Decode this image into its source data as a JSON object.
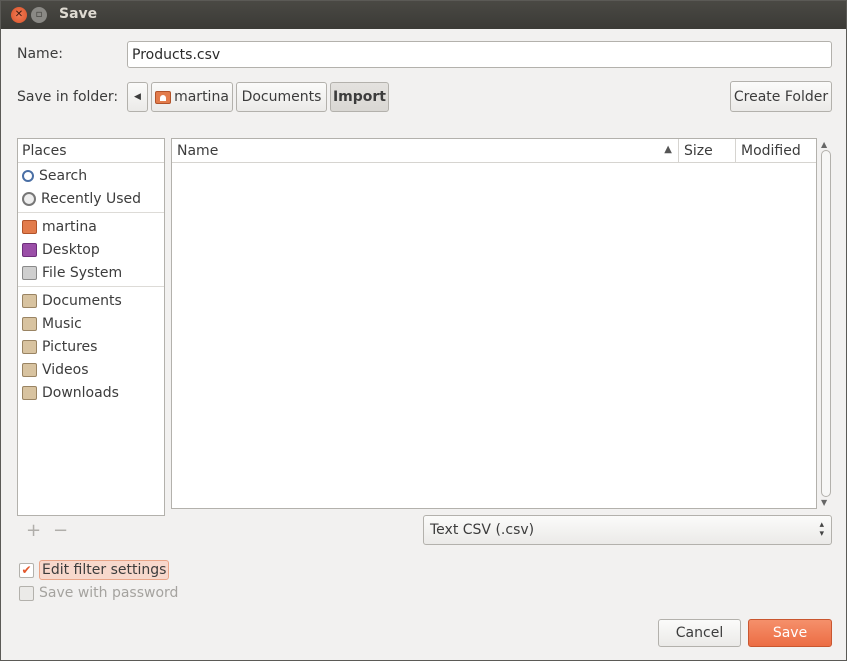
{
  "window": {
    "title": "Save"
  },
  "name_field": {
    "label": "Name:",
    "value": "Products.csv"
  },
  "folder_bar": {
    "label": "Save in folder:",
    "crumbs": [
      "martina",
      "Documents",
      "Import"
    ],
    "create_folder": "Create Folder"
  },
  "places": {
    "header": "Places",
    "items": [
      {
        "label": "Search",
        "icon": "search-icon"
      },
      {
        "label": "Recently Used",
        "icon": "clock-icon"
      },
      {
        "label": "martina",
        "icon": "home-folder-icon"
      },
      {
        "label": "Desktop",
        "icon": "desktop-icon"
      },
      {
        "label": "File System",
        "icon": "drive-icon"
      },
      {
        "label": "Documents",
        "icon": "documents-folder-icon"
      },
      {
        "label": "Music",
        "icon": "music-folder-icon"
      },
      {
        "label": "Pictures",
        "icon": "pictures-folder-icon"
      },
      {
        "label": "Videos",
        "icon": "videos-folder-icon"
      },
      {
        "label": "Downloads",
        "icon": "downloads-folder-icon"
      }
    ]
  },
  "file_list": {
    "columns": {
      "name": "Name",
      "size": "Size",
      "modified": "Modified"
    }
  },
  "filter": {
    "value": "Text CSV (.csv)"
  },
  "options": {
    "edit_filter": {
      "label": "Edit filter settings",
      "checked": true
    },
    "save_password": {
      "label": "Save with password",
      "checked": false
    }
  },
  "actions": {
    "cancel": "Cancel",
    "save": "Save"
  },
  "colors": {
    "accent": "#ec6d44",
    "titlebar": "#3c3b37"
  }
}
